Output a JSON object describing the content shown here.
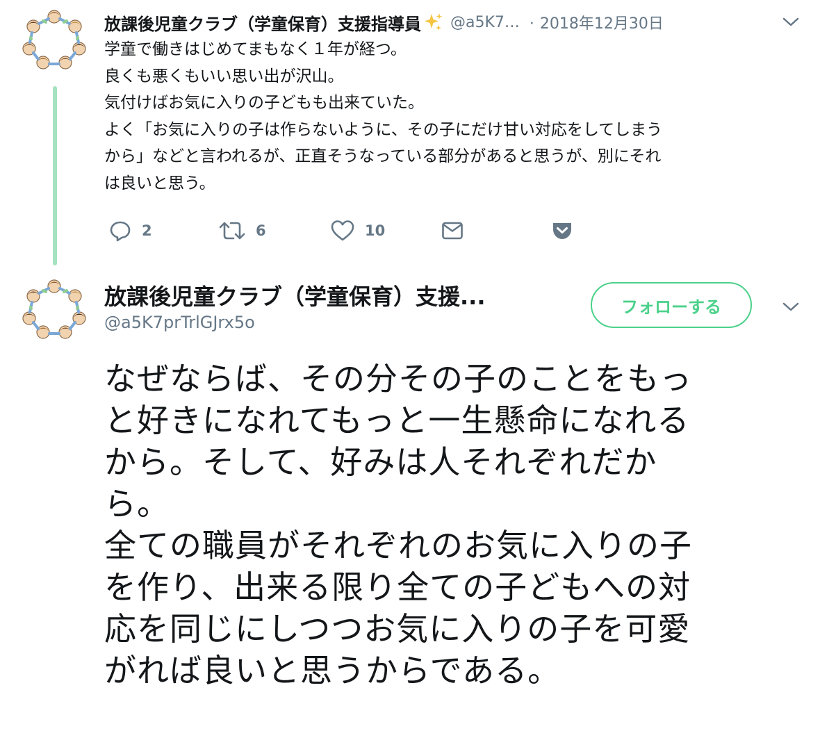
{
  "tweet1": {
    "author_name": "放課後児童クラブ（学童保育）支援指導員",
    "name_emoji": "sparkles-icon",
    "handle": "@a5K7…",
    "date": "2018年12月30日",
    "date_separator": "·",
    "lines": [
      "学童で働きはじめてまもなく１年が経つ。",
      "良くも悪くもいい思い出が沢山。",
      "気付けばお気に入りの子どもも出来ていた。",
      "よく「お気に入りの子は作らないように、その子にだけ甘い対応をしてしまう",
      "から」などと言われるが、正直そうなっている部分があると思うが、別にそれ",
      "は良いと思う。"
    ],
    "actions": {
      "reply_count": "2",
      "retweet_count": "6",
      "like_count": "10"
    }
  },
  "tweet2": {
    "author_name": "放課後児童クラブ（学童保育）支援...",
    "handle": "@a5K7prTrlGJrx5o",
    "follow_label": "フォローする",
    "lines": [
      "なぜならば、その分その子のことをもっ",
      "と好きになれてもっと一生懸命になれる",
      "から。そして、好みは人それぞれだか",
      "ら。",
      "全ての職員がそれぞれのお気に入りの子",
      "を作り、出来る限り全ての子どもへの対",
      "応を同じにしつつお気に入りの子を可愛",
      "がれば良いと思うからである。"
    ]
  },
  "colors": {
    "accent_green": "#4bd18a",
    "thread_line": "#a6e3c1",
    "secondary_text": "#657786",
    "primary_text": "#14171a"
  },
  "icons": [
    "avatar-children-circle",
    "sparkles-icon",
    "chevron-down-icon",
    "reply-icon",
    "retweet-icon",
    "like-icon",
    "dm-icon",
    "pocket-icon"
  ]
}
